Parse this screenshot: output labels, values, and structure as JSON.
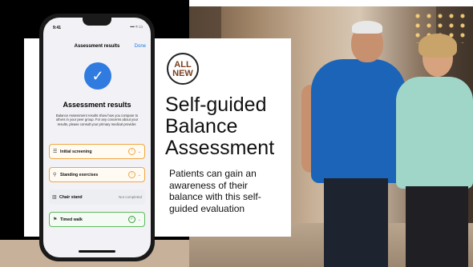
{
  "phone": {
    "status_time": "9:41",
    "status_icons": "▪▪▪ ≈ ▭",
    "nav_title": "Assessment results",
    "nav_done": "Done",
    "check_glyph": "✓",
    "results_title": "Assessment results",
    "results_desc": "Balance Assessment results show how you compare to others in your peer group. For any concerns about your results, please consult your primary medical provider.",
    "rows": [
      {
        "label": "Initial screening",
        "status": "",
        "icon": "list-icon",
        "glyph": "☰",
        "state": "warning"
      },
      {
        "label": "Standing exercises",
        "status": "",
        "icon": "person-standing-icon",
        "glyph": "⚲",
        "state": "warning"
      },
      {
        "label": "Chair stand",
        "status": "Not completed",
        "icon": "chair-icon",
        "glyph": "▥",
        "state": "not-completed"
      },
      {
        "label": "Timed walk",
        "status": "",
        "icon": "walking-icon",
        "glyph": "⚑",
        "state": "complete"
      }
    ]
  },
  "badge": {
    "line1": "ALL",
    "line2": "NEW"
  },
  "headline": "Self-guided Balance Assessment",
  "subtext": "Patients can gain an awareness of their balance with this self-guided evaluation",
  "colors": {
    "accent_blue": "#2f7be0",
    "warning_orange": "#f0a740",
    "ok_green": "#3a9a3a",
    "badge_brown": "#7a3f1e"
  }
}
